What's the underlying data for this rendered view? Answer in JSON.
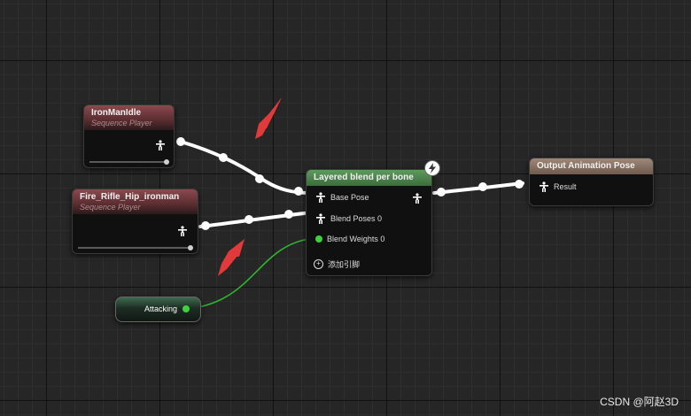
{
  "nodes": {
    "iron_man_idle": {
      "title": "IronManIdle",
      "subtitle": "Sequence Player"
    },
    "fire_rifle": {
      "title": "Fire_Rifle_Hip_ironman",
      "subtitle": "Sequence Player"
    },
    "layered_blend": {
      "title": "Layered blend per bone",
      "pins": {
        "base_pose": "Base Pose",
        "blend_poses_0": "Blend Poses 0",
        "blend_weights_0": "Blend Weights 0",
        "add_pin": "添加引脚"
      }
    },
    "output_pose": {
      "title": "Output Animation Pose",
      "result_label": "Result"
    },
    "attacking": {
      "label": "Attacking"
    }
  },
  "colors": {
    "exec_wire": "#ffffff",
    "bool_wire": "#2fb52f",
    "arrow": "#e23a3a",
    "header_red": "#8a4a4e",
    "header_green": "#5e9a5e",
    "header_tan": "#a08878"
  },
  "icons": [
    "pose-icon",
    "lightning-icon",
    "add-pin-icon",
    "bool-pin-icon",
    "annotation-arrow-icon"
  ],
  "watermark": "CSDN @阿赵3D"
}
